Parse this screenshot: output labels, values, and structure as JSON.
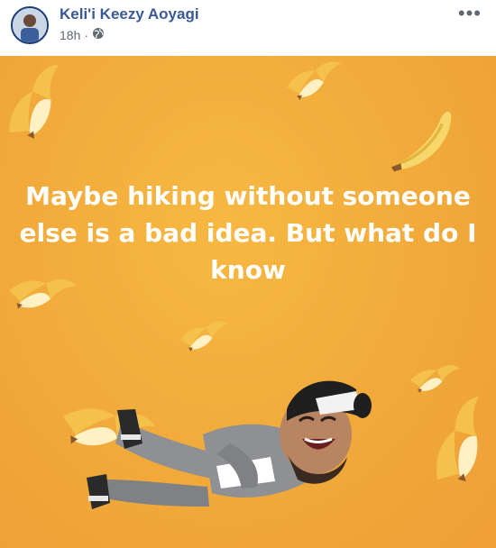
{
  "post": {
    "author": "Keli'i Keezy Aoyagi",
    "time": "18h",
    "separator": "·",
    "privacy_icon": "globe-icon",
    "more_icon": "more-horizontal-icon",
    "text": "Maybe hiking without someone else is a bad idea. But what do I know",
    "background_color": "#f2ac3b",
    "sticker": "avatar-lying-down-laughing"
  }
}
